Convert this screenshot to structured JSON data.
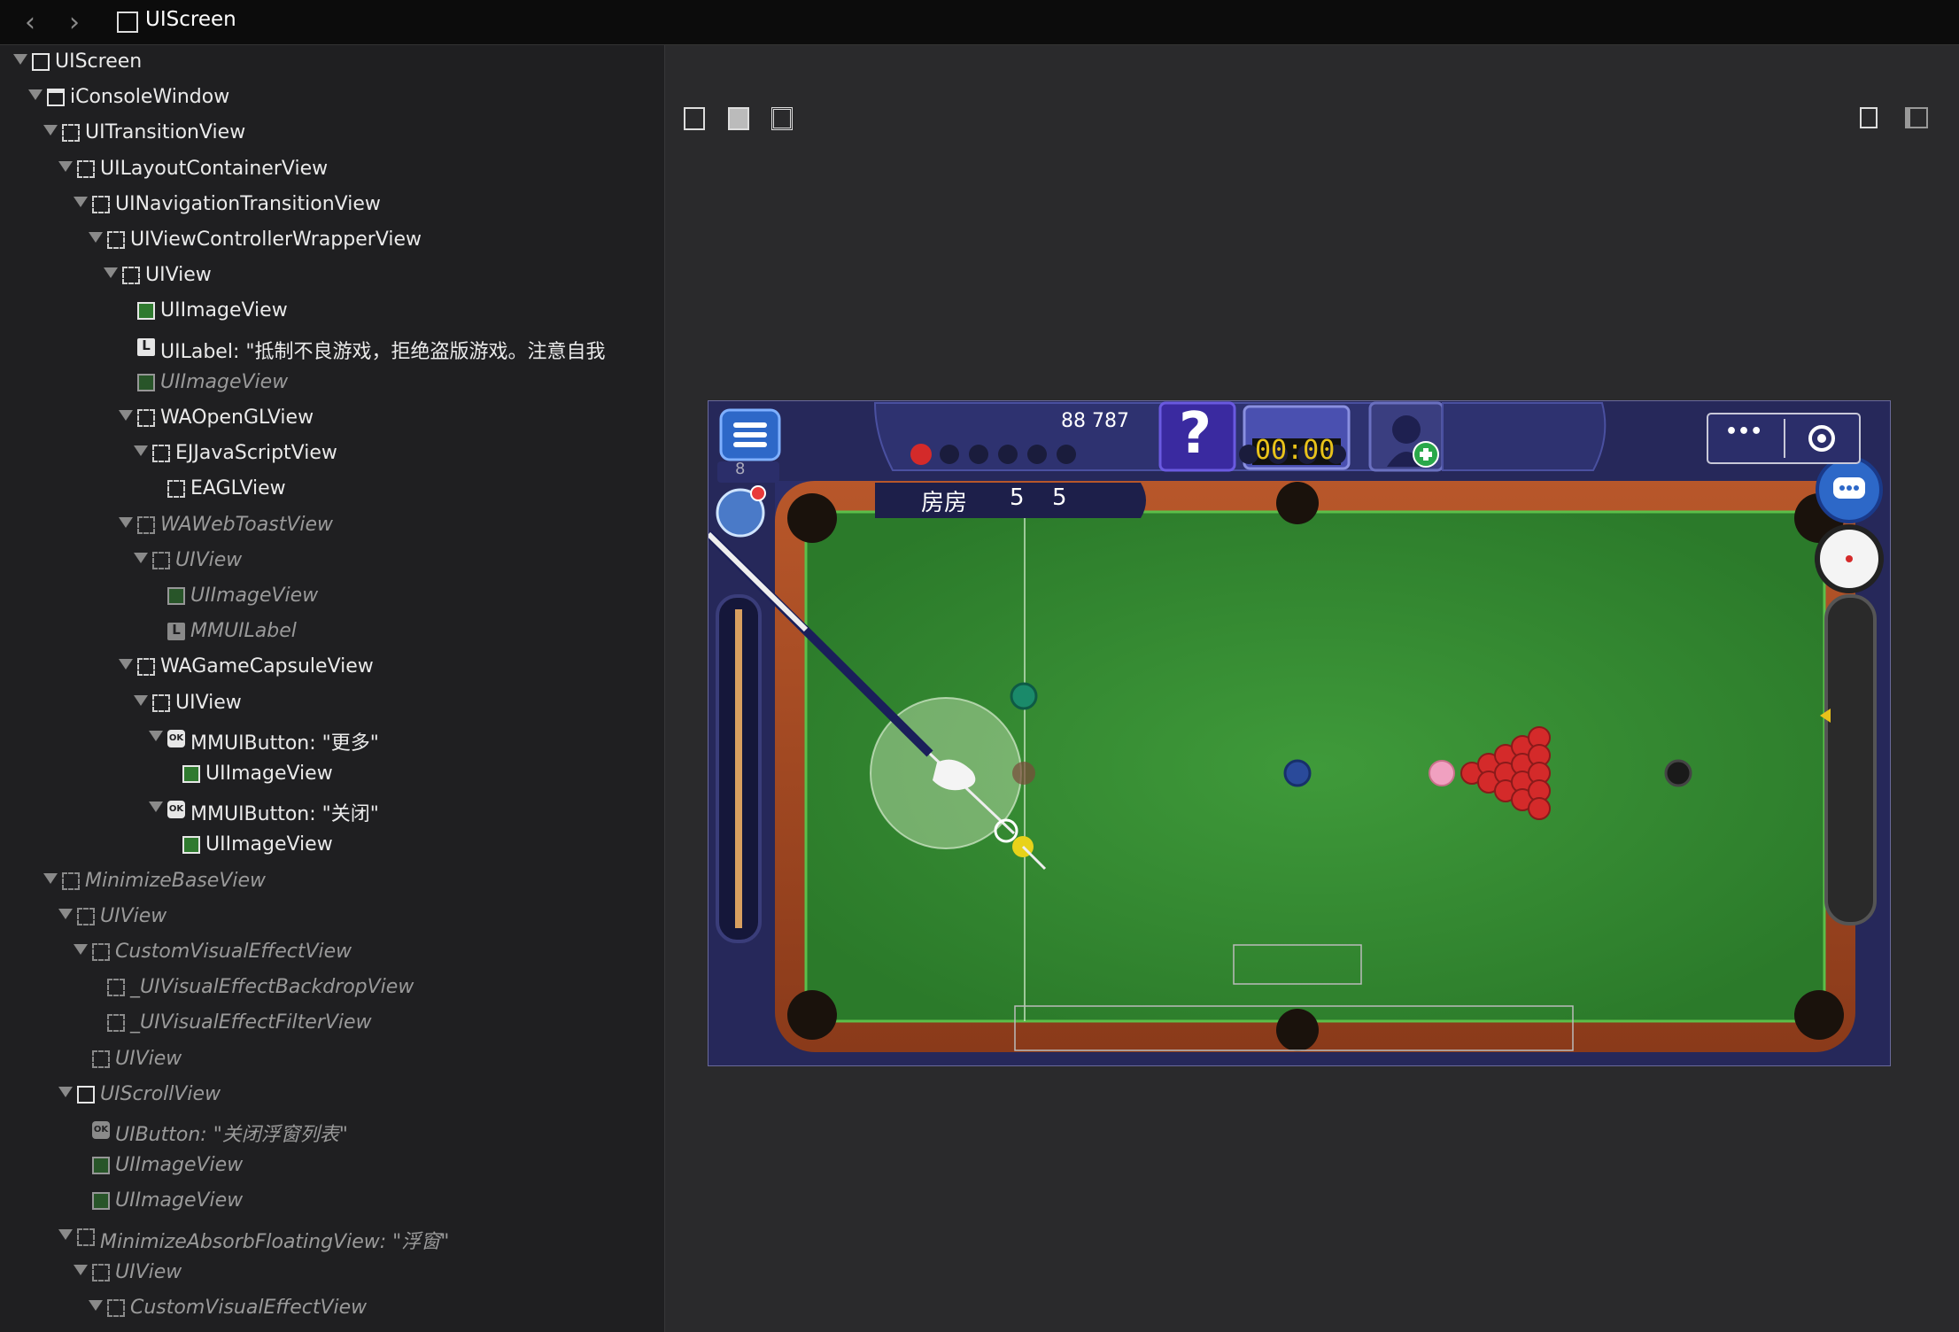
{
  "topbar": {
    "back": "‹",
    "forward": "›",
    "title": "UIScreen"
  },
  "tree": [
    {
      "depth": 0,
      "expanded": true,
      "icon": "solid",
      "label": "UIScreen",
      "hidden": false
    },
    {
      "depth": 1,
      "expanded": true,
      "icon": "window",
      "label": "iConsoleWindow",
      "hidden": false
    },
    {
      "depth": 2,
      "expanded": true,
      "icon": "dash",
      "label": "UITransitionView",
      "hidden": false
    },
    {
      "depth": 3,
      "expanded": true,
      "icon": "dash",
      "label": "UILayoutContainerView",
      "hidden": false
    },
    {
      "depth": 4,
      "expanded": true,
      "icon": "dash",
      "label": "UINavigationTransitionView",
      "hidden": false
    },
    {
      "depth": 5,
      "expanded": true,
      "icon": "dash",
      "label": "UIViewControllerWrapperView",
      "hidden": false
    },
    {
      "depth": 6,
      "expanded": true,
      "icon": "dash",
      "label": "UIView",
      "hidden": false
    },
    {
      "depth": 7,
      "expanded": false,
      "icon": "image",
      "label": "UIImageView",
      "hidden": false
    },
    {
      "depth": 7,
      "expanded": false,
      "icon": "label",
      "label": "UILabel: \"抵制不良游戏，拒绝盗版游戏。注意自我",
      "hidden": false
    },
    {
      "depth": 7,
      "expanded": false,
      "icon": "image",
      "label": "UIImageView",
      "hidden": true
    },
    {
      "depth": 7,
      "expanded": true,
      "icon": "dash",
      "label": "WAOpenGLView",
      "hidden": false
    },
    {
      "depth": 8,
      "expanded": true,
      "icon": "dash",
      "label": "EJJavaScriptView",
      "hidden": false
    },
    {
      "depth": 9,
      "expanded": false,
      "icon": "dash",
      "label": "EAGLView",
      "hidden": false
    },
    {
      "depth": 7,
      "expanded": true,
      "icon": "dash",
      "label": "WAWebToastView",
      "hidden": true
    },
    {
      "depth": 8,
      "expanded": true,
      "icon": "dash",
      "label": "UIView",
      "hidden": true
    },
    {
      "depth": 9,
      "expanded": false,
      "icon": "image",
      "label": "UIImageView",
      "hidden": true
    },
    {
      "depth": 9,
      "expanded": false,
      "icon": "label",
      "label": "MMUILabel",
      "hidden": true
    },
    {
      "depth": 7,
      "expanded": true,
      "icon": "dash",
      "label": "WAGameCapsuleView",
      "hidden": false
    },
    {
      "depth": 8,
      "expanded": true,
      "icon": "dash",
      "label": "UIView",
      "hidden": false
    },
    {
      "depth": 9,
      "expanded": true,
      "icon": "button",
      "label": "MMUIButton: \"更多\"",
      "hidden": false
    },
    {
      "depth": 10,
      "expanded": false,
      "icon": "image",
      "label": "UIImageView",
      "hidden": false
    },
    {
      "depth": 9,
      "expanded": true,
      "icon": "button",
      "label": "MMUIButton: \"关闭\"",
      "hidden": false
    },
    {
      "depth": 10,
      "expanded": false,
      "icon": "image",
      "label": "UIImageView",
      "hidden": false
    },
    {
      "depth": 2,
      "expanded": true,
      "icon": "dash",
      "label": "MinimizeBaseView",
      "hidden": true
    },
    {
      "depth": 3,
      "expanded": true,
      "icon": "dash",
      "label": "UIView",
      "hidden": true
    },
    {
      "depth": 4,
      "expanded": true,
      "icon": "dash",
      "label": "CustomVisualEffectView",
      "hidden": true
    },
    {
      "depth": 5,
      "expanded": false,
      "icon": "dash",
      "label": "_UIVisualEffectBackdropView",
      "hidden": true
    },
    {
      "depth": 5,
      "expanded": false,
      "icon": "dash",
      "label": "_UIVisualEffectFilterView",
      "hidden": true
    },
    {
      "depth": 4,
      "expanded": false,
      "icon": "dash",
      "label": "UIView",
      "hidden": true
    },
    {
      "depth": 3,
      "expanded": true,
      "icon": "scroll",
      "label": "UIScrollView",
      "hidden": true
    },
    {
      "depth": 4,
      "expanded": false,
      "icon": "button",
      "label": "UIButton: \"关闭浮窗列表\"",
      "hidden": true
    },
    {
      "depth": 4,
      "expanded": false,
      "icon": "image",
      "label": "UIImageView",
      "hidden": true
    },
    {
      "depth": 4,
      "expanded": false,
      "icon": "image",
      "label": "UIImageView",
      "hidden": true
    },
    {
      "depth": 3,
      "expanded": true,
      "icon": "dash",
      "label": "MinimizeAbsorbFloatingView: \"浮窗\"",
      "hidden": true
    },
    {
      "depth": 4,
      "expanded": true,
      "icon": "dash",
      "label": "UIView",
      "hidden": true
    },
    {
      "depth": 5,
      "expanded": true,
      "icon": "dash",
      "label": "CustomVisualEffectView",
      "hidden": true
    }
  ],
  "game": {
    "score": "88  787",
    "timer": "00:00",
    "room_label": "房房",
    "room_score_a": "5",
    "room_score_b": "5",
    "level": "8",
    "help": "?",
    "more_glyph": "•••",
    "ball_colors": {
      "red": "#d42a2a",
      "pink": "#f0a0c0",
      "blue": "#2a4a9a",
      "black": "#1a1a1a",
      "yellow": "#e8d21a",
      "green": "#1a8a6a",
      "brown": "#7a4a3a",
      "white": "#f2f2f2"
    }
  }
}
